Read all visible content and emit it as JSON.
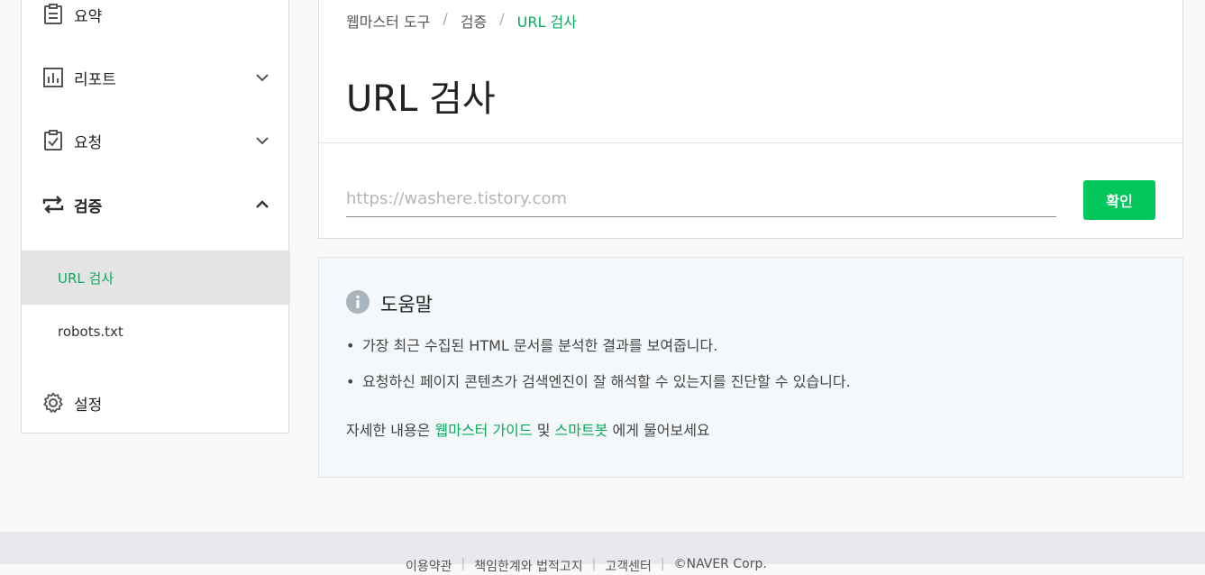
{
  "sidebar": {
    "items": [
      {
        "label": "요약",
        "icon": "clipboard-icon"
      },
      {
        "label": "리포트",
        "icon": "chart-icon"
      },
      {
        "label": "요청",
        "icon": "clipboard-check-icon"
      },
      {
        "label": "검증",
        "icon": "swap-arrows-icon"
      },
      {
        "label": "설정",
        "icon": "gear-icon"
      }
    ],
    "sub_items": [
      {
        "label": "URL 검사"
      },
      {
        "label": "robots.txt"
      }
    ]
  },
  "breadcrumb": {
    "items": [
      "웹마스터 도구",
      "검증",
      "URL 검사"
    ],
    "separator": "/"
  },
  "page": {
    "title": "URL 검사"
  },
  "url_form": {
    "placeholder": "https://washere.tistory.com",
    "button_label": "확인"
  },
  "help": {
    "title": "도움말",
    "bullets": [
      "가장 최근 수집된 HTML 문서를 분석한 결과를 보여줍니다.",
      "요청하신 페이지 콘텐츠가 검색엔진이 잘 해석할 수 있는지를 진단할 수 있습니다."
    ],
    "more_prefix": "자세한 내용은 ",
    "link_guide": "웹마스터 가이드",
    "conj": " 및 ",
    "link_bot": "스마트봇",
    "more_suffix": " 에게 물어보세요"
  },
  "footer": {
    "links": [
      "이용약관",
      "책임한계와 법적고지",
      "고객센터",
      "©NAVER Corp."
    ]
  },
  "colors": {
    "accent": "#03c75a",
    "accent_text": "#09aa5c",
    "help_bg": "#f4f8fa"
  }
}
